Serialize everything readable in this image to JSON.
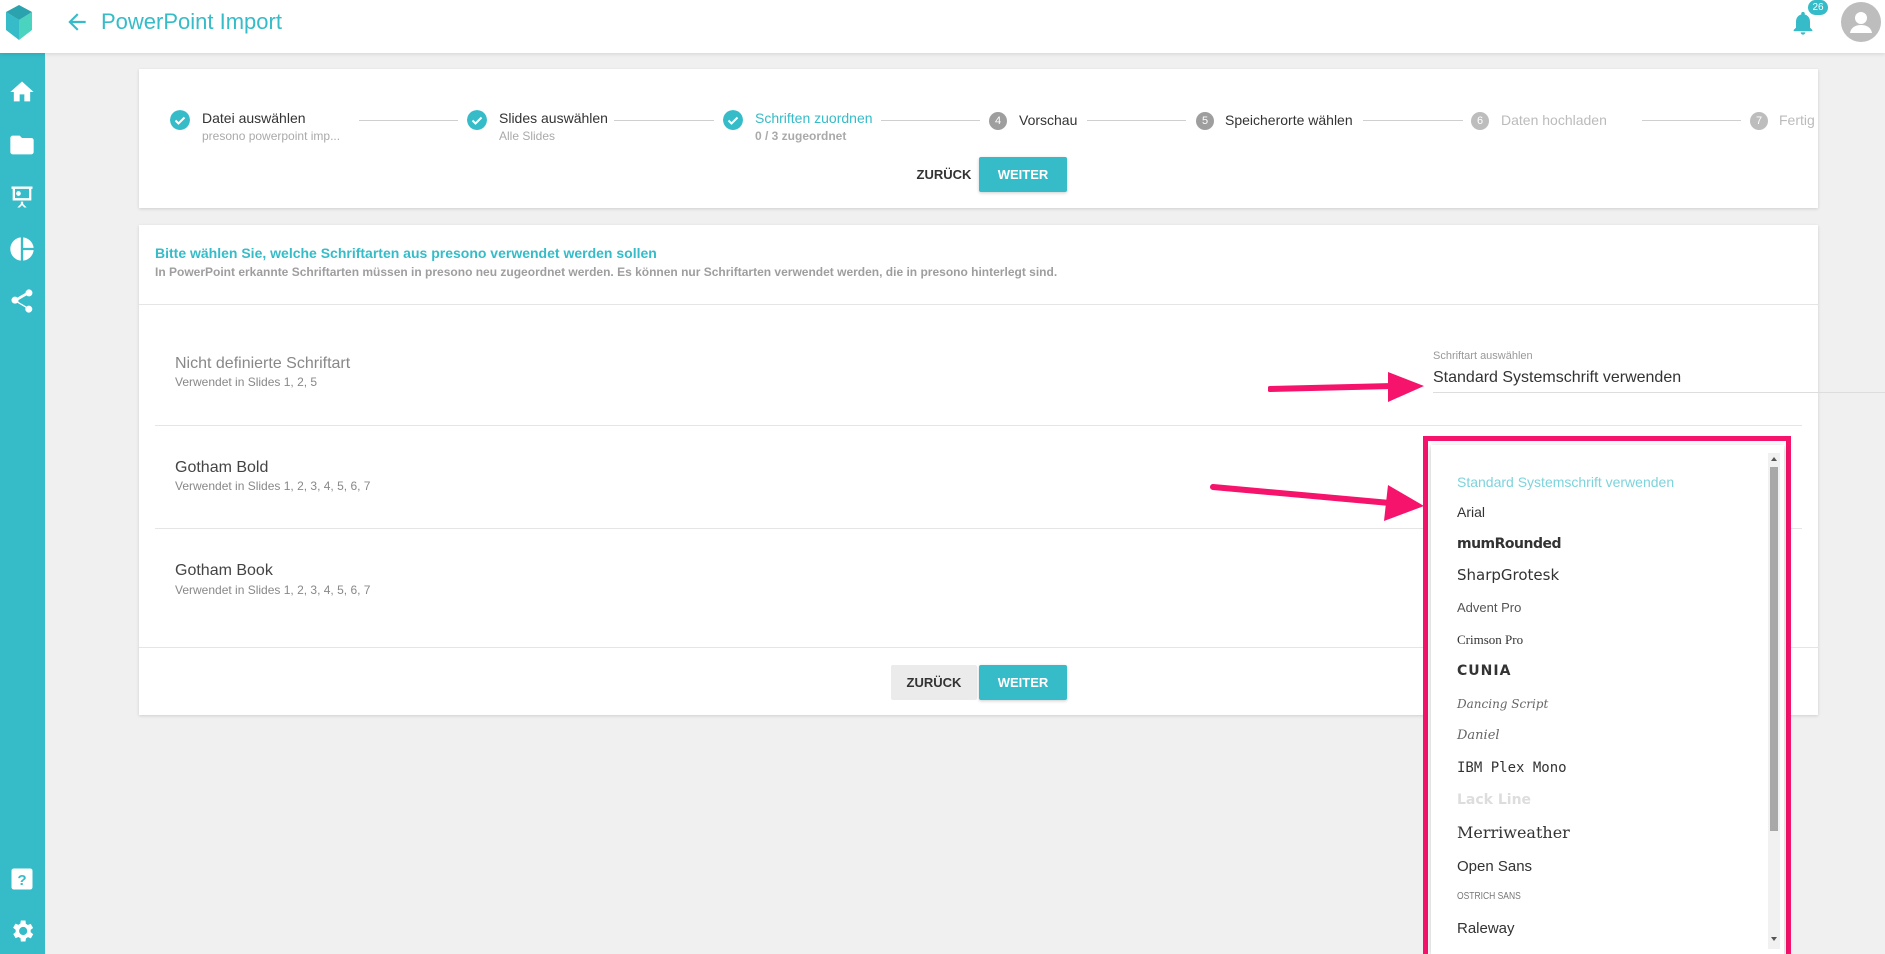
{
  "app": {
    "title": "PowerPoint Import",
    "notification_count": "26"
  },
  "sidebar": {
    "items": [
      {
        "name": "home-icon"
      },
      {
        "name": "folder-icon"
      },
      {
        "name": "presentation-icon"
      },
      {
        "name": "pie-chart-icon"
      },
      {
        "name": "share-icon"
      }
    ],
    "bottom": [
      {
        "name": "help-icon"
      },
      {
        "name": "gear-icon"
      }
    ]
  },
  "stepper": {
    "steps": [
      {
        "num": "1",
        "title": "Datei auswählen",
        "sub": "presono powerpoint imp...",
        "state": "done"
      },
      {
        "num": "2",
        "title": "Slides auswählen",
        "sub": "Alle Slides",
        "state": "done"
      },
      {
        "num": "3",
        "title": "Schriften zuordnen",
        "sub": "0 / 3 zugeordnet",
        "state": "active"
      },
      {
        "num": "4",
        "title": "Vorschau",
        "sub": "",
        "state": "todo"
      },
      {
        "num": "5",
        "title": "Speicherorte wählen",
        "sub": "",
        "state": "todo"
      },
      {
        "num": "6",
        "title": "Daten hochladen",
        "sub": "",
        "state": "disabled"
      },
      {
        "num": "7",
        "title": "Fertig",
        "sub": "",
        "state": "disabled"
      }
    ],
    "back_label": "ZURÜCK",
    "next_label": "WEITER"
  },
  "main": {
    "intro_title": "Bitte wählen Sie, welche Schriftarten aus presono verwendet werden sollen",
    "intro_desc": "In PowerPoint erkannte Schriftarten müssen in presono neu zugeordnet werden. Es können nur Schriftarten verwendet werden, die in presono hinterlegt sind.",
    "fonts": [
      {
        "name": "Nicht definierte Schriftart",
        "usage": "Verwendet in Slides 1, 2, 5"
      },
      {
        "name": "Gotham Bold",
        "usage": "Verwendet in Slides 1, 2, 3, 4, 5, 6, 7"
      },
      {
        "name": "Gotham Book",
        "usage": "Verwendet in Slides 1, 2, 3, 4, 5, 6, 7"
      }
    ],
    "select_label": "Schriftart auswählen",
    "select_value": "Standard Systemschrift verwenden",
    "back_label": "ZURÜCK",
    "next_label": "WEITER"
  },
  "dropdown": {
    "options": [
      "Standard Systemschrift verwenden",
      "Arial",
      "mumRounded",
      "SharpGrotesk",
      "Advent Pro",
      "Crimson Pro",
      "CUNIA",
      "Dancing Script",
      "Daniel",
      "IBM Plex Mono",
      "Lack Line",
      "Merriweather",
      "Open Sans",
      "OSTRICH SANS",
      "Raleway"
    ],
    "selected": "Standard Systemschrift verwenden"
  },
  "colors": {
    "accent": "#35bcc8",
    "highlight": "#f5136b",
    "step_inactive": "#9e9e9e"
  }
}
